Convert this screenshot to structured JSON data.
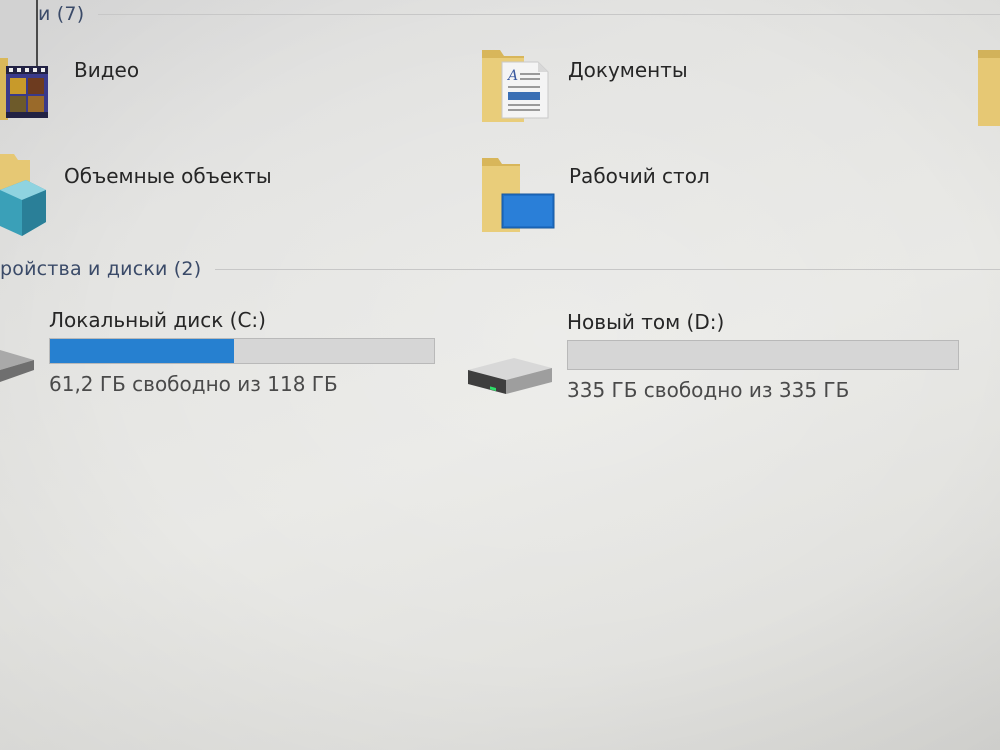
{
  "sections": {
    "folders": {
      "title": "и (7)"
    },
    "drives": {
      "title": "ройства и диски (2)"
    }
  },
  "folders": {
    "video": {
      "label": "Видео",
      "icon": "video-folder-icon"
    },
    "documents": {
      "label": "Документы",
      "icon": "documents-folder-icon"
    },
    "objects3d": {
      "label": "Объемные объекты",
      "icon": "3d-objects-folder-icon"
    },
    "desktop": {
      "label": "Рабочий стол",
      "icon": "desktop-folder-icon"
    }
  },
  "drives": {
    "c": {
      "name": "Локальный диск (C:)",
      "free_text": "61,2 ГБ свободно из 118 ГБ",
      "used_fraction": 0.48,
      "bar_color": "#2680d0"
    },
    "d": {
      "name": "Новый том (D:)",
      "free_text": "335 ГБ свободно из 335 ГБ",
      "used_fraction": 0.0,
      "bar_color": "#2680d0"
    }
  }
}
